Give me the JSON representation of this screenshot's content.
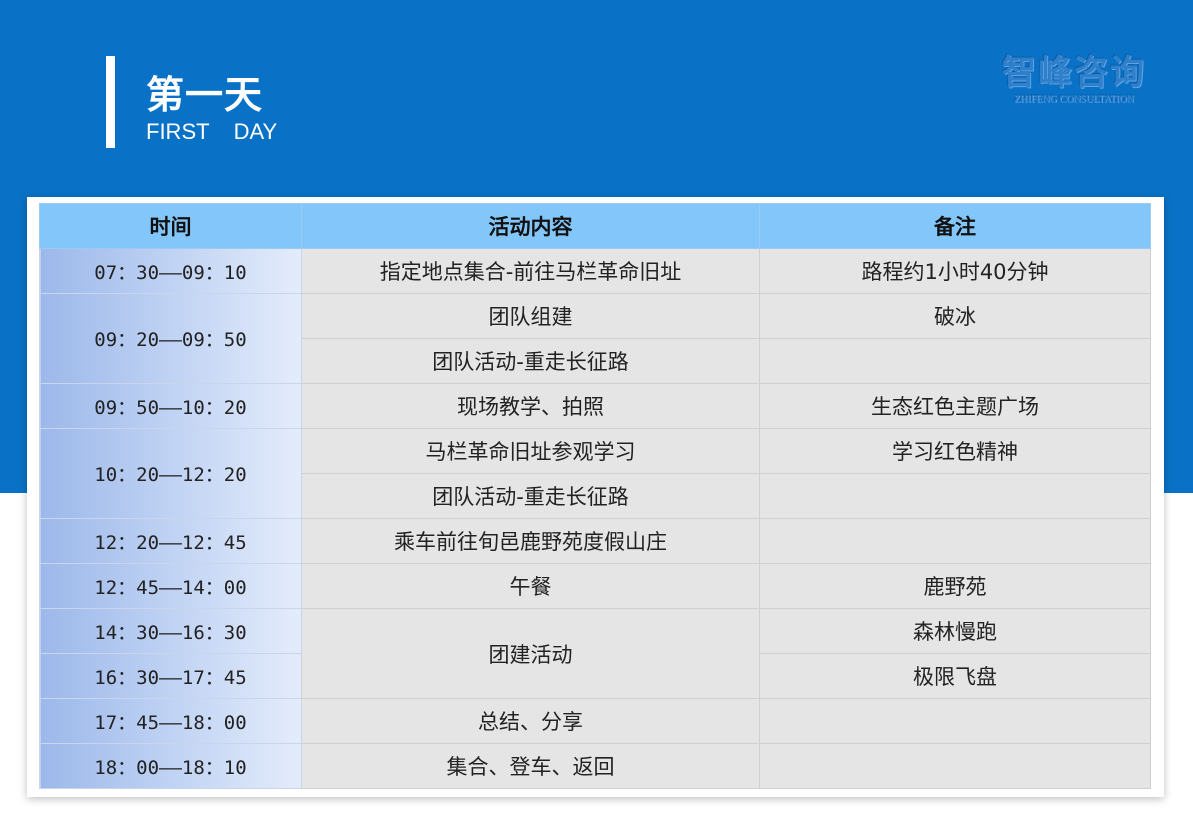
{
  "header": {
    "title": "第一天",
    "subtitle": "FIRST    DAY",
    "logo_cn": "智峰咨询",
    "logo_en": "ZHIFENG CONSULTATION"
  },
  "table": {
    "columns": [
      "时间",
      "活动内容",
      "备注"
    ],
    "rows": [
      {
        "time": "07：30——09：10",
        "activity": "指定地点集合-前往马栏革命旧址",
        "note": "路程约1小时40分钟"
      },
      {
        "time": "09：20——09：50",
        "activity": "团队组建",
        "note": "破冰"
      },
      {
        "activity": "团队活动-重走长征路",
        "note": ""
      },
      {
        "time": "09：50——10：20",
        "activity": "现场教学、拍照",
        "note": "生态红色主题广场"
      },
      {
        "time": "10：20——12：20",
        "activity": "马栏革命旧址参观学习",
        "note": "学习红色精神"
      },
      {
        "activity": "团队活动-重走长征路",
        "note": ""
      },
      {
        "time": "12：20——12：45",
        "activity": "乘车前往旬邑鹿野苑度假山庄",
        "note": ""
      },
      {
        "time": "12：45——14：00",
        "activity": "午餐",
        "note": "鹿野苑"
      },
      {
        "time": "14：30——16：30",
        "activity": "团建活动",
        "note": "森林慢跑"
      },
      {
        "time": "16：30——17：45",
        "note": "极限飞盘"
      },
      {
        "time": "17：45——18：00",
        "activity": "总结、分享",
        "note": ""
      },
      {
        "time": "18：00——18：10",
        "activity": "集合、登车、返回",
        "note": ""
      }
    ]
  }
}
